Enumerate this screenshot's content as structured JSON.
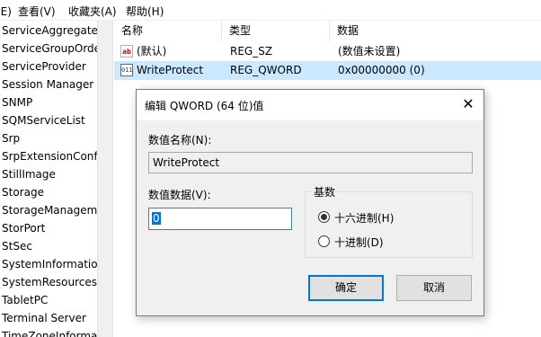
{
  "menubar": {
    "items": [
      "编辑(E)",
      "查看(V)",
      "收藏夹(A)",
      "帮助(H)"
    ]
  },
  "tree": {
    "items": [
      "ServiceAggregate",
      "ServiceGroupOrde",
      "ServiceProvider",
      "Session Manager",
      "SNMP",
      "SQMServiceList",
      "Srp",
      "SrpExtensionConfi",
      "StillImage",
      "Storage",
      "StorageManagem",
      "StorPort",
      "StSec",
      "SystemInformatio",
      "SystemResources",
      "TabletPC",
      "Terminal Server",
      "TimeZoneInforma"
    ]
  },
  "list": {
    "columns": [
      "名称",
      "类型",
      "数据"
    ],
    "rows": [
      {
        "icon": "string-value-icon",
        "icon_text": "ab",
        "name": "(默认)",
        "type": "REG_SZ",
        "data": "(数值未设置)"
      },
      {
        "icon": "binary-value-icon",
        "icon_text": "011",
        "name": "WriteProtect",
        "type": "REG_QWORD",
        "data": "0x00000000 (0)"
      }
    ]
  },
  "dialog": {
    "title": "编辑 QWORD (64 位)值",
    "close_glyph": "✕",
    "value_name_label": "数值名称(N):",
    "value_name": "WriteProtect",
    "value_data_label": "数值数据(V):",
    "value_data": "0",
    "base_label": "基数",
    "radio_hex": "十六进制(H)",
    "radio_dec": "十进制(D)",
    "selected_base": "hex",
    "ok_label": "确定",
    "cancel_label": "取消"
  },
  "colors": {
    "selection": "#cce8ff",
    "accent": "#0078d7"
  }
}
